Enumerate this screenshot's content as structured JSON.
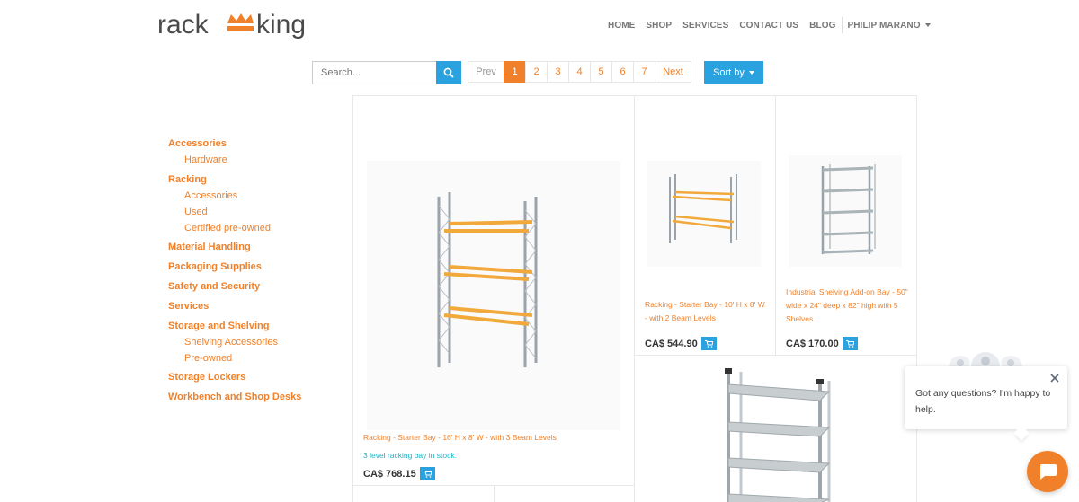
{
  "brand": {
    "logo_left": "rack",
    "logo_right": "king",
    "accent": "#f0812a",
    "logo_text": "#4a4a4a"
  },
  "nav": {
    "items": [
      "HOME",
      "SHOP",
      "SERVICES",
      "CONTACT US",
      "BLOG"
    ],
    "user": "PHILIP MARANO"
  },
  "search": {
    "placeholder": "Search...",
    "icon": "search-icon"
  },
  "pager": {
    "prev": "Prev",
    "pages": [
      "1",
      "2",
      "3",
      "4",
      "5",
      "6",
      "7"
    ],
    "active": "1",
    "next": "Next"
  },
  "sort": {
    "label": "Sort by"
  },
  "sidebar": {
    "items": [
      {
        "label": "Accessories",
        "children": [
          "Hardware"
        ]
      },
      {
        "label": "Racking",
        "children": [
          "Accessories",
          "Used",
          "Certified pre-owned"
        ]
      },
      {
        "label": "Material Handling",
        "children": []
      },
      {
        "label": "Packaging Supplies",
        "children": []
      },
      {
        "label": "Safety and Security",
        "children": []
      },
      {
        "label": "Services",
        "children": []
      },
      {
        "label": "Storage and Shelving",
        "children": [
          "Shelving Accessories",
          "Pre-owned"
        ]
      },
      {
        "label": "Storage Lockers",
        "children": []
      },
      {
        "label": "Workbench and Shop Desks",
        "children": []
      }
    ]
  },
  "products": [
    {
      "title": "Racking - Starter Bay - 16' H x 8' W - with 3 Beam Levels",
      "desc": "3 level racking bay in stock.",
      "price": "CA$ 768.15"
    },
    {
      "title": "Racking - Starter Bay - 10' H x 8' W - with 2 Beam Levels",
      "price": "CA$ 544.90"
    },
    {
      "title": "Industrial Shelving Add-on Bay - 50\" wide x 24\" deep x 82\" high with 5 Shelves",
      "price": "CA$ 170.00"
    }
  ],
  "chat": {
    "message": "Got any questions? I'm happy to help."
  }
}
